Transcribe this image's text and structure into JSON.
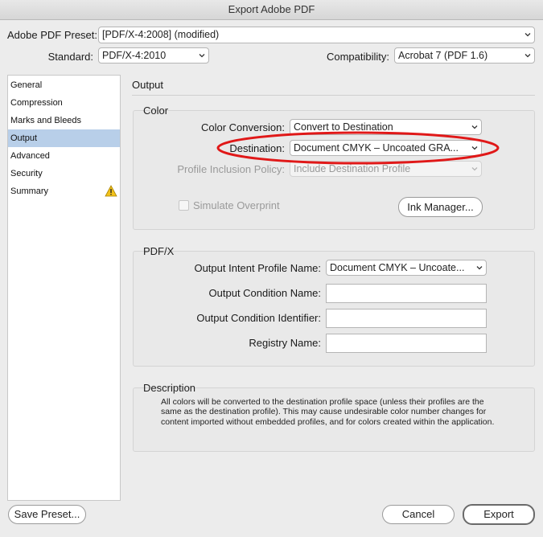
{
  "window": {
    "title": "Export Adobe PDF"
  },
  "preset": {
    "label": "Adobe PDF Preset:",
    "value": "[PDF/X-4:2008] (modified)"
  },
  "standard": {
    "label": "Standard:",
    "value": "PDF/X-4:2010"
  },
  "compatibility": {
    "label": "Compatibility:",
    "value": "Acrobat 7 (PDF 1.6)"
  },
  "sidebar": {
    "items": [
      {
        "label": "General"
      },
      {
        "label": "Compression"
      },
      {
        "label": "Marks and Bleeds"
      },
      {
        "label": "Output",
        "selected": true
      },
      {
        "label": "Advanced"
      },
      {
        "label": "Security"
      },
      {
        "label": "Summary",
        "icon": "warning-icon"
      }
    ]
  },
  "panel": {
    "title": "Output"
  },
  "color": {
    "title": "Color",
    "conversion_label": "Color Conversion:",
    "conversion_value": "Convert to Destination",
    "destination_label": "Destination:",
    "destination_value": "Document CMYK – Uncoated GRA...",
    "policy_label": "Profile Inclusion Policy:",
    "policy_value": "Include Destination Profile",
    "simulate_label": "Simulate Overprint",
    "ink_manager_label": "Ink Manager..."
  },
  "pdfx": {
    "title": "PDF/X",
    "intent_label": "Output Intent Profile Name:",
    "intent_value": "Document CMYK – Uncoate...",
    "condition_name_label": "Output Condition Name:",
    "condition_name_value": "",
    "condition_id_label": "Output Condition Identifier:",
    "condition_id_value": "",
    "registry_label": "Registry Name:",
    "registry_value": ""
  },
  "description": {
    "title": "Description",
    "line1": "All colors will be converted to the destination profile space (unless their profiles are the",
    "line2": "same as the destination profile). This may cause undesirable color number changes for",
    "line3": "content imported without embedded profiles, and for colors created within the application."
  },
  "footer": {
    "save_preset_label": "Save Preset...",
    "cancel_label": "Cancel",
    "export_label": "Export"
  },
  "colors": {
    "highlight_ellipse": "#e01818",
    "selection": "#b8cfe9",
    "warning": "#f2c21b"
  }
}
